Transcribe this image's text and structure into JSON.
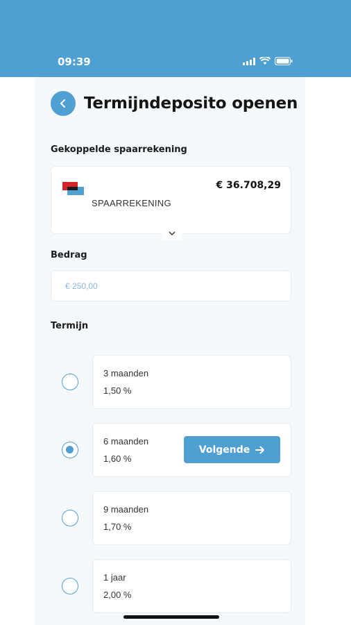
{
  "status_bar": {
    "time": "09:39"
  },
  "header": {
    "title": "Termijndeposito openen"
  },
  "linked_account": {
    "label": "Gekoppelde spaarrekening",
    "type": "SPAARREKENING",
    "balance": "€ 36.708,29"
  },
  "amount": {
    "label": "Bedrag",
    "placeholder": "€ 250,00"
  },
  "term": {
    "label": "Termijn",
    "options": [
      {
        "term": "3 maanden",
        "rate": "1,50 %",
        "selected": false
      },
      {
        "term": "6 maanden",
        "rate": "1,60 %",
        "selected": true
      },
      {
        "term": "9 maanden",
        "rate": "1,70 %",
        "selected": false
      },
      {
        "term": "1 jaar",
        "rate": "2,00 %",
        "selected": false
      }
    ]
  },
  "next_button": {
    "label": "Volgende"
  },
  "colors": {
    "accent": "#4f9fd2",
    "background": "#f6f9fc"
  }
}
